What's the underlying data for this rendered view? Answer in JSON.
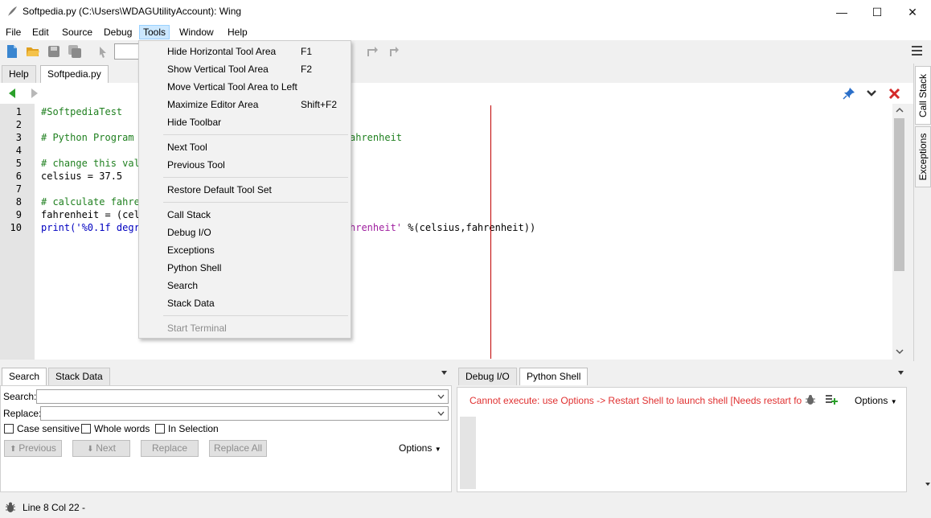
{
  "window": {
    "title": "Softpedia.py (C:\\Users\\WDAGUtilityAccount): Wing",
    "minimize": "—",
    "maximize": "☐",
    "close": "✕"
  },
  "menubar": [
    "File",
    "Edit",
    "Source",
    "Debug",
    "Tools",
    "Window",
    "Help"
  ],
  "editor_tabs": [
    "Help",
    "Softpedia.py"
  ],
  "editor": {
    "line_numbers": [
      "1",
      "2",
      "3",
      "4",
      "5",
      "6",
      "7",
      "8",
      "9",
      "10"
    ],
    "lines": [
      "#SoftpediaTest",
      "",
      "# Python Program ",
      "",
      "# change this valu",
      "celsius = 37.5",
      "",
      "# calculate fahren",
      "fahrenheit = (cels",
      "print('%0.1f degre"
    ],
    "line3_tail": "ahrenheit",
    "line10_tail_str": "hrenheit'",
    "line10_tail_rest": " %(celsius,fahrenheit))"
  },
  "tools_menu": {
    "items": [
      {
        "label": "Hide Horizontal Tool Area",
        "shortcut": "F1"
      },
      {
        "label": "Show Vertical Tool Area",
        "shortcut": "F2"
      },
      {
        "label": "Move Vertical Tool Area to Left",
        "shortcut": ""
      },
      {
        "label": "Maximize Editor Area",
        "shortcut": "Shift+F2"
      },
      {
        "label": "Hide Toolbar",
        "shortcut": ""
      },
      {
        "label": "Next Tool",
        "shortcut": ""
      },
      {
        "label": "Previous Tool",
        "shortcut": ""
      },
      {
        "label": "Restore Default Tool Set",
        "shortcut": ""
      },
      {
        "label": "Call Stack",
        "shortcut": ""
      },
      {
        "label": "Debug I/O",
        "shortcut": ""
      },
      {
        "label": "Exceptions",
        "shortcut": ""
      },
      {
        "label": "Python Shell",
        "shortcut": ""
      },
      {
        "label": "Search",
        "shortcut": ""
      },
      {
        "label": "Stack Data",
        "shortcut": ""
      },
      {
        "label": "Start Terminal",
        "shortcut": ""
      }
    ]
  },
  "right_tabs": [
    "Call Stack",
    "Exceptions"
  ],
  "search_panel": {
    "tabs": [
      "Search",
      "Stack Data"
    ],
    "search_label": "Search:",
    "replace_label": "Replace:",
    "checks": [
      "Case sensitive",
      "Whole words",
      "In Selection"
    ],
    "buttons": [
      "Previous",
      "Next",
      "Replace",
      "Replace All"
    ],
    "options": "Options"
  },
  "shell_panel": {
    "tabs": [
      "Debug I/O",
      "Python Shell"
    ],
    "message": "Cannot execute: use Options -> Restart Shell to launch shell [Needs restart fo",
    "options": "Options"
  },
  "statusbar": {
    "text": "Line 8 Col 22 -"
  },
  "colors": {
    "accent_red": "#e03030",
    "menu_highlight": "#cce8ff",
    "error_text": "#e03030"
  }
}
